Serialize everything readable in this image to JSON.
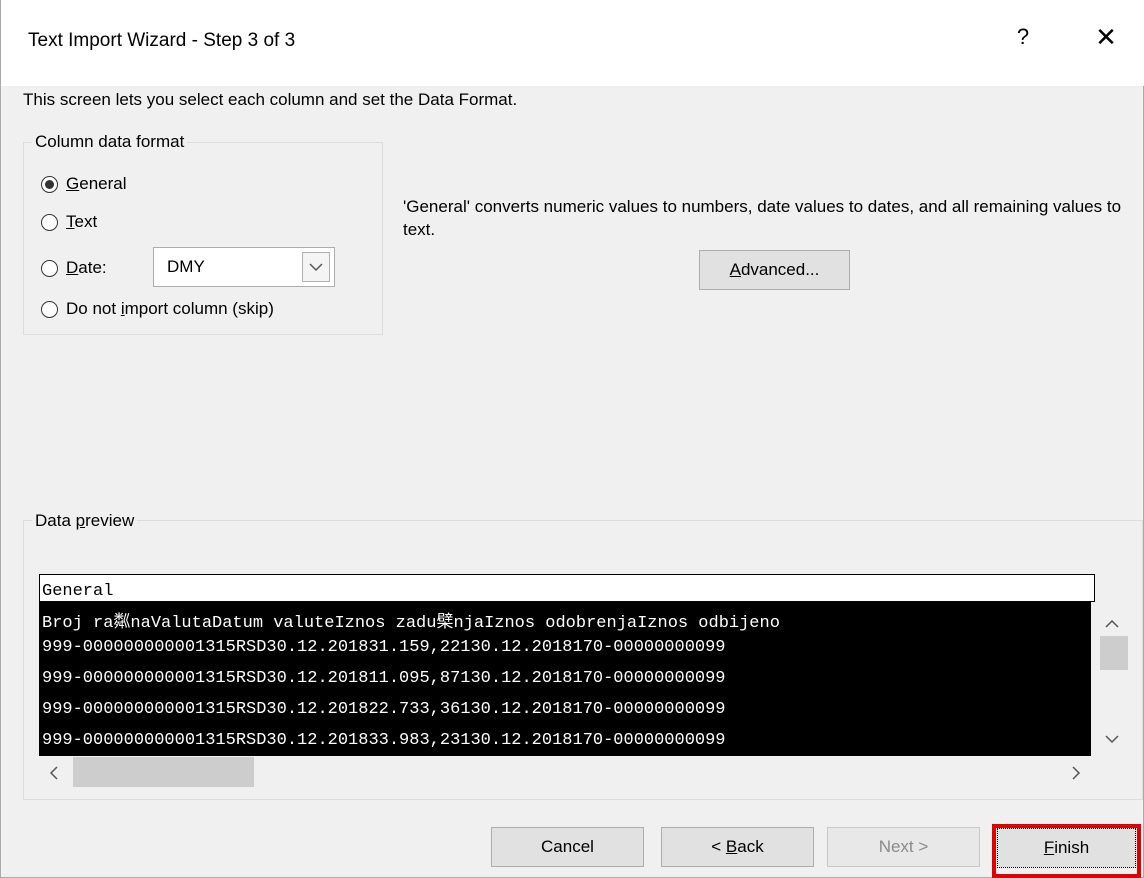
{
  "window": {
    "title": "Text Import Wizard - Step 3 of 3",
    "help_label": "?",
    "close_label": "✕"
  },
  "intro": "This screen lets you select each column and set the Data Format.",
  "column_format": {
    "label": "Column data format",
    "options": [
      {
        "label_prefix": "",
        "mnemonic": "G",
        "label_rest": "eneral",
        "selected": true
      },
      {
        "label_prefix": "",
        "mnemonic": "T",
        "label_rest": "ext",
        "selected": false
      },
      {
        "label_prefix": "",
        "mnemonic": "D",
        "label_rest": "ate:",
        "selected": false
      },
      {
        "label_prefix": "Do not ",
        "mnemonic": "i",
        "label_rest": "mport column (skip)",
        "selected": false
      }
    ],
    "date_combo": {
      "value": "DMY"
    }
  },
  "description": "'General' converts numeric values to numbers, date values to dates, and all remaining values to text.",
  "advanced_button": {
    "mnemonic": "A",
    "rest": "dvanced..."
  },
  "preview": {
    "label_prefix": "Data ",
    "label_mnemonic": "p",
    "label_rest": "review",
    "column_header": "General",
    "rows": [
      "Broj ra粼naValutaDatum valuteIznos zadu檗njaIznos odobrenjaIznos odbijeno",
      "999-000000000001315RSD30.12.201831.159,22130.12.2018170-00000000099",
      "999-000000000001315RSD30.12.201811.095,87130.12.2018170-00000000099",
      "999-000000000001315RSD30.12.201822.733,36130.12.2018170-00000000099",
      "999-000000000001315RSD30.12.201833.983,23130.12.2018170-00000000099"
    ]
  },
  "buttons": {
    "cancel": "Cancel",
    "back_prefix": "< ",
    "back_mnemonic": "B",
    "back_rest": "ack",
    "next": "Next >",
    "finish_mnemonic": "F",
    "finish_rest": "inish"
  },
  "colors": {
    "highlight": "#e00000",
    "preview_bg": "#000000"
  }
}
